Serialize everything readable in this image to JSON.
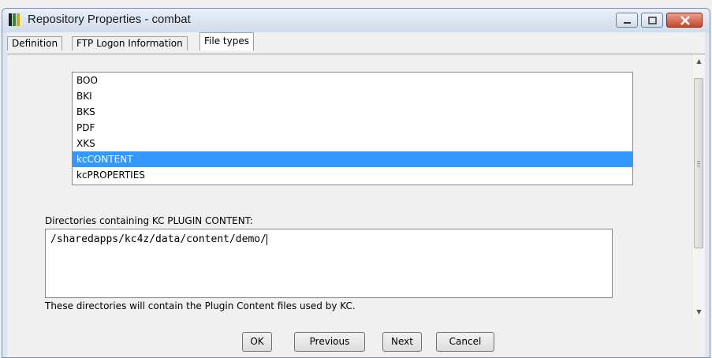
{
  "window": {
    "title": "Repository Properties - combat"
  },
  "tabs": [
    {
      "label": "Definition"
    },
    {
      "label": "FTP Logon Information"
    },
    {
      "label": "File types"
    }
  ],
  "file_types": {
    "items": [
      "BOO",
      "BKI",
      "BKS",
      "PDF",
      "XKS",
      "kcCONTENT",
      "kcPROPERTIES"
    ],
    "selected": "kcCONTENT"
  },
  "directories": {
    "label": "Directories containing KC PLUGIN CONTENT:",
    "value": "/sharedapps/kc4z/data/content/demo/",
    "description": "These directories will contain the Plugin Content files used by KC."
  },
  "buttons": {
    "ok": "OK",
    "previous": "Previous",
    "next": "Next",
    "cancel": "Cancel"
  },
  "colors": {
    "selection": "#3399ff",
    "title_bar": "#dde6f1",
    "close_button": "#c5462c"
  },
  "icons": {
    "app": "repository-app-icon",
    "minimize": "minimize-icon",
    "maximize": "maximize-icon",
    "close": "close-icon",
    "scroll_up": "scroll-up-icon",
    "scroll_down": "scroll-down-icon"
  }
}
